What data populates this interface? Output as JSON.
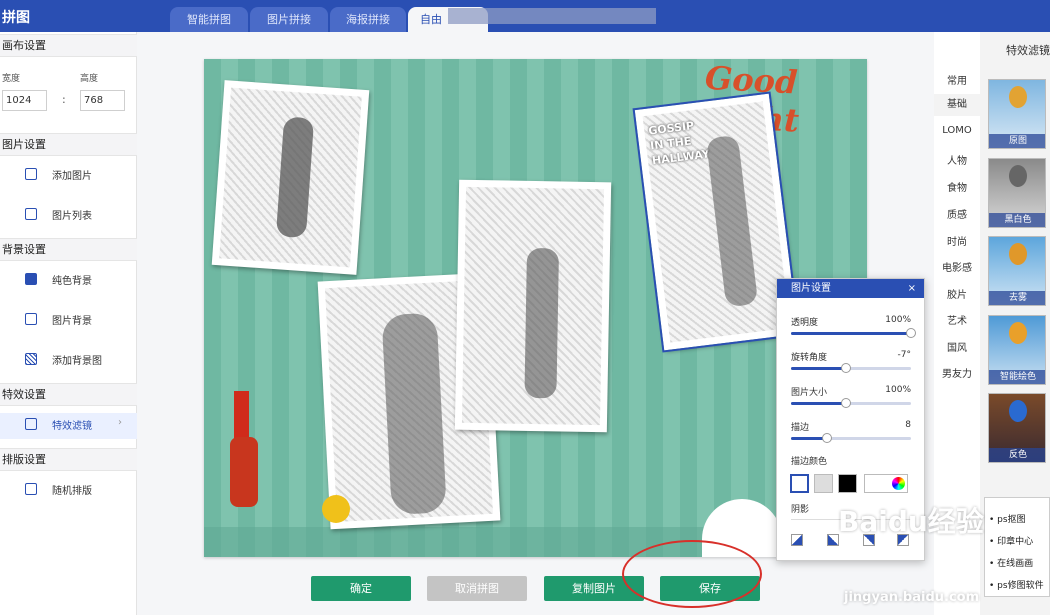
{
  "app": {
    "title": "拼图"
  },
  "tabs": [
    {
      "label": "智能拼图"
    },
    {
      "label": "图片拼接"
    },
    {
      "label": "海报拼接"
    },
    {
      "label": "自由"
    }
  ],
  "sidebar": {
    "canvas_section": "画布设置",
    "width_label": "宽度",
    "height_label": "高度",
    "width_value": "1024",
    "height_value": "768",
    "separator": ":",
    "image_section": "图片设置",
    "add_image": "添加图片",
    "image_list": "图片列表",
    "bg_section": "背景设置",
    "solid_bg": "纯色背景",
    "image_bg": "图片背景",
    "add_bg_image": "添加背景图",
    "effects_section": "特效设置",
    "effects_filter": "特效滤镜",
    "chevron": "›",
    "layout_section": "排版设置",
    "random_layout": "随机排版"
  },
  "canvas": {
    "poster_title": "Good night",
    "photo_caption": "GOSSIP\nIN THE\nHALLWAY"
  },
  "buttons": {
    "confirm": "确定",
    "cancel": "取消拼图",
    "copy": "复制图片",
    "save": "保存"
  },
  "right_nav": {
    "header": "特效滤镜",
    "categories": [
      "常用",
      "基础",
      "LOMO",
      "人物",
      "食物",
      "质感",
      "时尚",
      "电影感",
      "胶片",
      "艺术",
      "国风",
      "男友力"
    ]
  },
  "filters": [
    {
      "label": "原图"
    },
    {
      "label": "黑白色"
    },
    {
      "label": "去雾"
    },
    {
      "label": "智能绘色"
    },
    {
      "label": "反色"
    }
  ],
  "dialog": {
    "title": "图片设置",
    "close": "×",
    "opacity_label": "透明度",
    "opacity_value": "100%",
    "opacity_level": 1.0,
    "rotation_label": "旋转角度",
    "rotation_value": "-7°",
    "rotation_level": 0.46,
    "size_label": "图片大小",
    "size_value": "100%",
    "size_level": 0.46,
    "border_label": "描边",
    "border_value": "8",
    "border_level": 0.3,
    "border_color_label": "描边颜色",
    "shadow_label": "阴影"
  },
  "context_menu": {
    "items": [
      "ps抠图",
      "印章中心",
      "在线画画",
      "ps修图软件"
    ]
  },
  "watermark": {
    "brand": "Baidu经验",
    "url": "jingyan.baidu.com"
  },
  "colors": {
    "accent": "#2a4fb3",
    "button_green": "#1f9a6d",
    "button_disabled": "#c4c4c4",
    "annotation_red": "#d8302a"
  }
}
